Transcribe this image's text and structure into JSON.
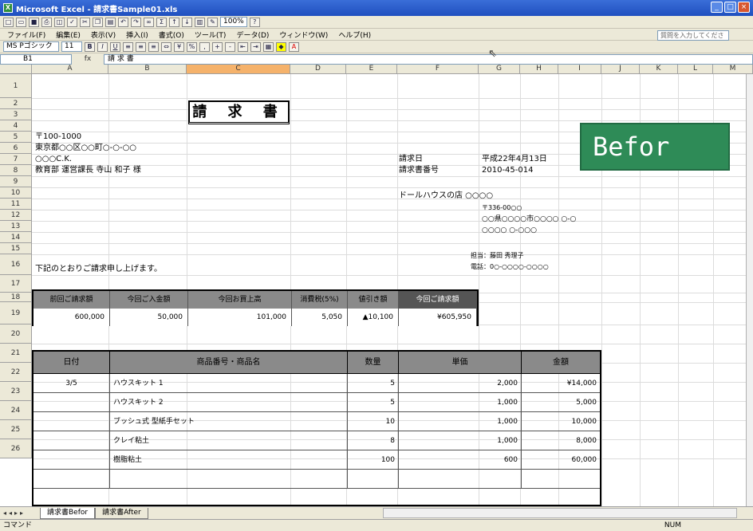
{
  "window": {
    "title": "Microsoft Excel - 請求書Sample01.xls",
    "controls": [
      "_",
      "□",
      "×"
    ]
  },
  "toolbar1": {
    "zoom": "100%"
  },
  "menu": [
    "ファイル(F)",
    "編集(E)",
    "表示(V)",
    "挿入(I)",
    "書式(O)",
    "ツール(T)",
    "データ(D)",
    "ウィンドウ(W)",
    "ヘルプ(H)"
  ],
  "ask_box": "質問を入力してください",
  "font_toolbar": {
    "font_name": "MS Pゴシック",
    "font_size": "11"
  },
  "formula_bar": {
    "name_box": "B1",
    "fx": "fx",
    "content": "請 求 書"
  },
  "columns": [
    "A",
    "B",
    "C",
    "D",
    "E",
    "F",
    "G",
    "H",
    "I",
    "J",
    "K",
    "L",
    "M"
  ],
  "active_column": "C",
  "rows": [
    "1",
    "2",
    "3",
    "4",
    "5",
    "6",
    "7",
    "8",
    "9",
    "10",
    "11",
    "12",
    "13",
    "14",
    "15",
    "16",
    "17",
    "18",
    "19",
    "20",
    "21",
    "22",
    "23",
    "24",
    "25",
    "26"
  ],
  "document": {
    "title": "請 求 書",
    "postal": "〒100-1000",
    "address": "東京都○○区○○町○-○-○○",
    "company": "○○○C.K.",
    "recipient": "教育部 運営課長 寺山 和子 様",
    "invoice_date_label": "請求日",
    "invoice_date": "平成22年4月13日",
    "invoice_no_label": "請求書番号",
    "invoice_no": "2010-45-014",
    "issuer_name": "ドールハウスの店 ○○○○",
    "issuer_postal": "〒336-00○○",
    "issuer_address": "○○県○○○○市○○○○ ○-○",
    "issuer_address2": "○○○○ ○-○○○",
    "contact": "担当：藤田 秀理子",
    "phone": "電話：0○-○○○○-○○○○",
    "message": "下記のとおりご請求申し上げます。"
  },
  "summary": {
    "headers": [
      "前回ご請求額",
      "今回ご入金額",
      "今回お買上高",
      "消費税(5%)",
      "値引き額",
      "今回ご請求額"
    ],
    "values": [
      "600,000",
      "50,000",
      "101,000",
      "5,050",
      "▲10,100",
      "¥605,950"
    ]
  },
  "detail": {
    "headers": [
      "日付",
      "商品番号・商品名",
      "数量",
      "単価",
      "金額"
    ],
    "rows": [
      {
        "date": "3/5",
        "item": "ハウスキット 1",
        "qty": "5",
        "price": "2,000",
        "amount": "¥14,000"
      },
      {
        "date": "",
        "item": "ハウスキット 2",
        "qty": "5",
        "price": "1,000",
        "amount": "5,000"
      },
      {
        "date": "",
        "item": "ブッシュ式 型紙手セット",
        "qty": "10",
        "price": "1,000",
        "amount": "10,000"
      },
      {
        "date": "",
        "item": "クレイ粘土",
        "qty": "8",
        "price": "1,000",
        "amount": "8,000"
      },
      {
        "date": "",
        "item": "樹脂粘土",
        "qty": "100",
        "price": "600",
        "amount": "60,000"
      },
      {
        "date": "",
        "item": "",
        "qty": "",
        "price": "",
        "amount": ""
      }
    ]
  },
  "overlay_label": "Befor",
  "sheet_tabs": [
    "請求書Befor",
    "請求書After"
  ],
  "status": {
    "left": "コマンド",
    "right": "NUM"
  },
  "colors": {
    "titlebar": "#2456c8",
    "header_gray": "#8a8a8a",
    "overlay_green": "#2e8b57"
  }
}
